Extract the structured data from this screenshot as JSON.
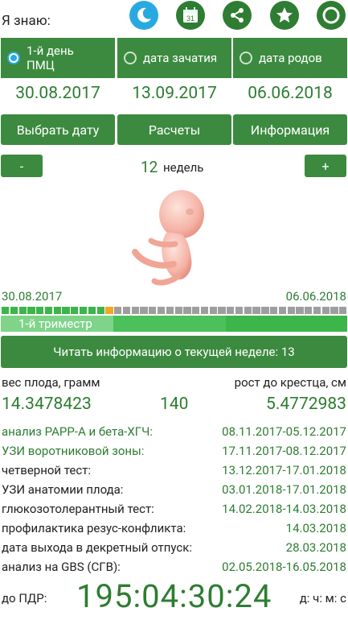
{
  "header": {
    "label": "Я знаю:"
  },
  "toolbar_icons": [
    "theme-icon",
    "calendar-icon",
    "share-icon",
    "star-icon",
    "circle-icon"
  ],
  "calendar_icon_text": "31",
  "modes": [
    {
      "label": "1-й день ПМЦ",
      "selected": true
    },
    {
      "label": "дата зачатия",
      "selected": false
    },
    {
      "label": "дата родов",
      "selected": false
    }
  ],
  "dates": {
    "pmc": "30.08.2017",
    "conception": "13.09.2017",
    "birth": "06.06.2018"
  },
  "buttons": {
    "choose_date": "Выбрать дату",
    "calculations": "Расчеты",
    "info": "Информация"
  },
  "week": {
    "minus": "-",
    "plus": "+",
    "value": "12",
    "unit": "недель"
  },
  "timeline": {
    "start": "30.08.2017",
    "end": "06.06.2018",
    "filled_weeks": 12,
    "current_week_index": 12,
    "total_weeks": 40,
    "trimester_label": "1-й триместр"
  },
  "read_button": "Читать информацию о текущей неделе: 13",
  "metrics": {
    "weight_label": "вес плода, грамм",
    "height_label": "рост до крестца, см",
    "weight_value": "14.3478423",
    "middle_value": "140",
    "height_value": "5.4772983"
  },
  "schedule": [
    {
      "label": "анализ PAPP-A и бета-ХГЧ:",
      "value": "08.11.2017-05.12.2017",
      "highlight": true
    },
    {
      "label": "УЗИ воротниковой зоны:",
      "value": "17.11.2017-08.12.2017",
      "highlight": true
    },
    {
      "label": "четверной тест:",
      "value": "13.12.2017-17.01.2018",
      "highlight": false
    },
    {
      "label": "УЗИ анатомии плода:",
      "value": "03.01.2018-17.01.2018",
      "highlight": false
    },
    {
      "label": "глюкозотолерантный тест:",
      "value": "14.02.2018-14.03.2018",
      "highlight": false
    },
    {
      "label": "профилактика резус-конфликта:",
      "value": "14.03.2018",
      "highlight": false
    },
    {
      "label": "дата выхода в декретный отпуск:",
      "value": "28.03.2018",
      "highlight": false
    },
    {
      "label": "анализ на GBS (СГВ):",
      "value": "02.05.2018-16.05.2018",
      "highlight": false
    }
  ],
  "countdown": {
    "label": "до ПДР:",
    "value": "195:04:30:24",
    "units": "д: ч: м: с"
  },
  "colors": {
    "primary": "#3c8a3f",
    "text_green": "#2e7d32",
    "accent_blue": "#29a9e1",
    "current_week": "#f5a623",
    "future_week": "#9e9e9e"
  }
}
